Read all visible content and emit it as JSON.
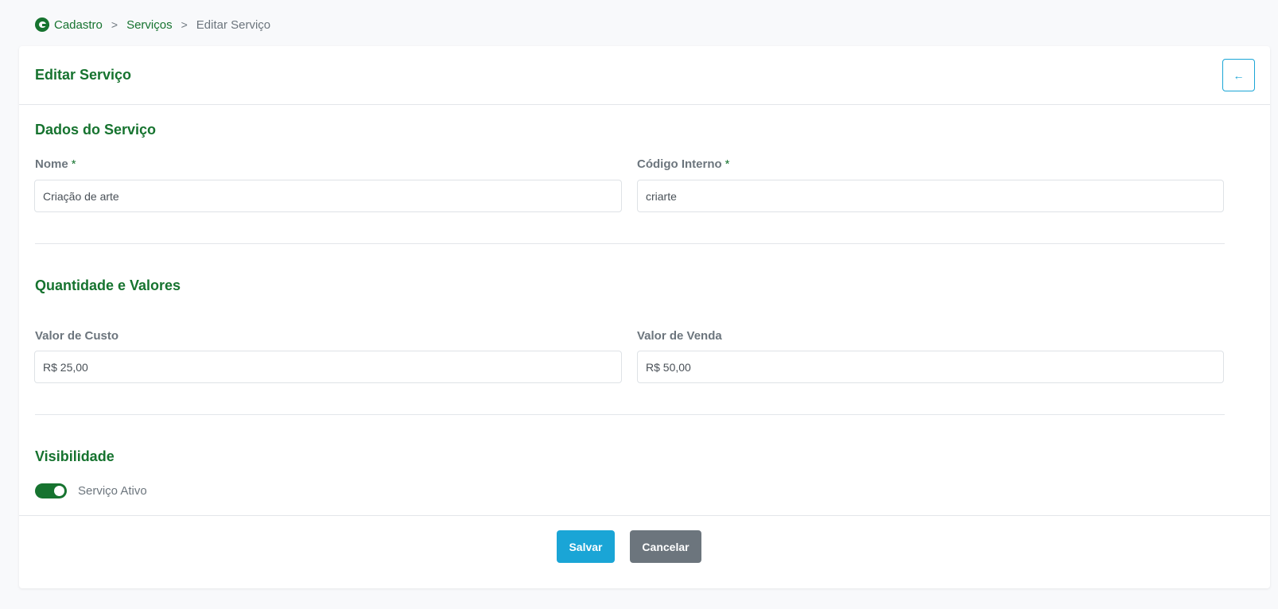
{
  "breadcrumb": {
    "logo_icon": "brand-logo-icon",
    "items": [
      "Cadastro",
      "Serviços",
      "Editar Serviço"
    ],
    "separator": ">"
  },
  "card": {
    "title": "Editar Serviço",
    "back_icon": "←"
  },
  "sections": {
    "service_data": {
      "title": "Dados do Serviço",
      "name_label": "Nome",
      "name_value": "Criação de arte",
      "code_label": "Código Interno",
      "code_value": "criarte",
      "required_mark": "*"
    },
    "values": {
      "title": "Quantidade e Valores",
      "cost_label": "Valor de Custo",
      "cost_value": "R$ 25,00",
      "sale_label": "Valor de Venda",
      "sale_value": "R$ 50,00"
    },
    "visibility": {
      "title": "Visibilidade",
      "active_label": "Serviço Ativo",
      "active": true
    }
  },
  "footer": {
    "save_label": "Salvar",
    "cancel_label": "Cancelar"
  },
  "colors": {
    "brand": "#16732f",
    "accent": "#1aa5d6",
    "secondary": "#6c757d"
  }
}
